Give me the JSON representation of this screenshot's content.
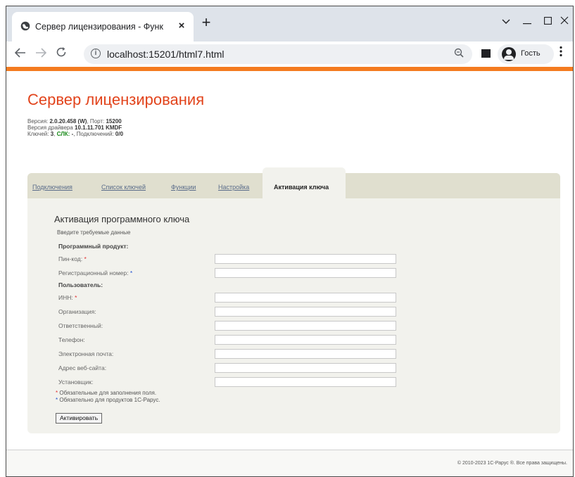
{
  "browser": {
    "tab_title": "Сервер лицензирования - Функ",
    "tab_close": "×",
    "new_tab": "+",
    "url": "localhost:15201/html7.html",
    "profile_label": "Гость",
    "window_buttons": [
      "chevron-down",
      "minimize",
      "maximize",
      "close"
    ]
  },
  "header": {
    "title": "Сервер лицензирования",
    "version_label": "Версия:",
    "version_value": "2.0.20.458 (W)",
    "port_label": ", Порт:",
    "port_value": "15200",
    "driver_label": "Версия драйвера",
    "driver_value": "10.1.11.701 KMDF",
    "keys_label": "Ключей:",
    "keys_value": "3",
    "slk_label": "СЛК:",
    "slk_value": "-",
    "connections_label": ", Подключений:",
    "connections_value": "0/0"
  },
  "tabs": [
    {
      "label": "Подключения"
    },
    {
      "label": "Список ключей"
    },
    {
      "label": "Функции"
    },
    {
      "label": "Настройка"
    }
  ],
  "active_tab": "Активация ключа",
  "form": {
    "title": "Активация программного ключа",
    "subtitle": "Введите требуемые данные",
    "group_product": "Программный продукт:",
    "group_user": "Пользователь:",
    "fields": {
      "pin": {
        "label": "Пин-код:",
        "value": ""
      },
      "reg": {
        "label": "Регистрационный номер:",
        "value": ""
      },
      "inn": {
        "label": "ИНН:",
        "value": ""
      },
      "org": {
        "label": "Организация:",
        "value": ""
      },
      "resp": {
        "label": "Ответственный:",
        "value": ""
      },
      "phone": {
        "label": "Телефон:",
        "value": ""
      },
      "email": {
        "label": "Электронная почта:",
        "value": ""
      },
      "site": {
        "label": "Адрес веб-сайта:",
        "value": ""
      },
      "installer": {
        "label": "Установщик:",
        "value": ""
      }
    },
    "required_mark": "*",
    "note_required": "Обязательные для заполнения поля.",
    "note_rarus": "Обязательно для продуктов 1С-Рарус.",
    "activate_button": "Активировать"
  },
  "footer": {
    "copyright": "© 2010-2023 1С-Рарус ®. Все права защищены."
  },
  "colors": {
    "accent_orange": "#f47b20",
    "title_red": "#e2441c",
    "required_red": "#e03030",
    "required_blue": "#2050d0"
  }
}
